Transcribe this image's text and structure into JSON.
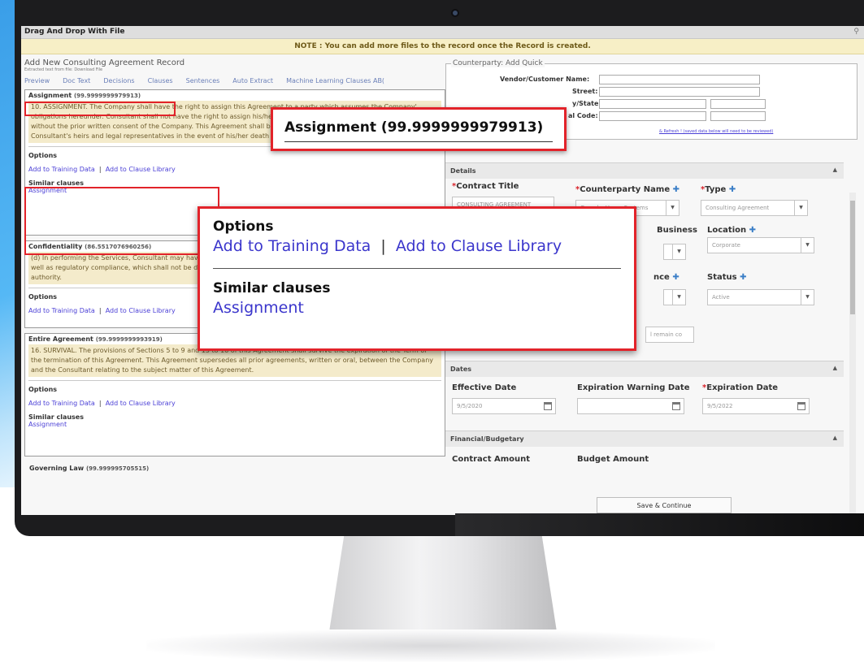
{
  "window": {
    "title": "Drag And Drop With File"
  },
  "note": "NOTE : You can add more files to the record once the Record is created.",
  "left": {
    "record_title": "Add New Consulting Agreement Record",
    "extracted": "Extracted text from file: Download File",
    "tabs": [
      "Preview",
      "Doc Text",
      "Decisions",
      "Clauses",
      "Sentences",
      "Auto Extract",
      "Machine Learning Clauses AB("
    ],
    "clauses": [
      {
        "title": "Assignment",
        "score": "(99.9999999979913)",
        "text": "10. ASSIGNMENT. The Company shall have the right to assign this Agreement to a party which assumes the Company' obligations hereunder. Consultant shall not have the right to assign his/her rights or obligations under this Agreement without the prior written consent of the Company. This Agreement shall be binding upon and inure to the benefit of the Consultant's heirs and legal representatives in the event of his/her death or disability.",
        "options_label": "Options",
        "link_training": "Add to Training Data",
        "link_sep": "|",
        "link_library": "Add to Clause Library",
        "similar_label": "Similar clauses",
        "similar": "Assignment"
      },
      {
        "title": "Confidentiality",
        "score": "(86.5517076960256)",
        "text": "(d) In performing the Services, Consultant may have access to confidential information regarding business operations as well as regulatory compliance, which shall not be disclosed except at the request of the Company for any governmental authority.",
        "options_label": "Options",
        "link_training": "Add to Training Data",
        "link_sep": "|",
        "link_library": "Add to Clause Library"
      },
      {
        "title": "Entire Agreement",
        "score": "(99.9999999993919)",
        "text": "16. SURVIVAL. The provisions of Sections 5 to 9 and 15 to 16 of this Agreement shall survive the expiration of the Term or the termination of this Agreement. This Agreement supersedes all prior agreements, written or oral, between the Company and the Consultant relating to the subject matter of this Agreement.",
        "options_label": "Options",
        "link_training": "Add to Training Data",
        "link_sep": "|",
        "link_library": "Add to Clause Library",
        "similar_label": "Similar clauses",
        "similar": "Assignment"
      },
      {
        "title": "Governing Law",
        "score": "(99.999995705515)"
      }
    ]
  },
  "right": {
    "counterparty_legend": "Counterparty: Add Quick",
    "vendor_label": "Vendor/Customer Name:",
    "street_label": "Street:",
    "city_label": "y/State:",
    "postal_label": "al Code:",
    "refresh_link": "& Refresh ! (saved data below will need to be reviewed)",
    "details": "Details",
    "contract_title_label": "Contract Title",
    "contract_title_value": "CONSULTING AGREEMENT",
    "counterparty_name_label": "Counterparty Name",
    "counterparty_value": "ComplexHome Systems",
    "type_label": "Type",
    "type_value": "Consulting Agreement",
    "business_label": "Business",
    "location_label": "Location",
    "location_value": "Corporate",
    "nce_label": "nce",
    "status_label": "Status",
    "status_value": "Active",
    "remain_value": "l remain co",
    "dates": "Dates",
    "effective_label": "Effective Date",
    "effective_value": "9/5/2020",
    "warning_label": "Expiration Warning Date",
    "expiration_label": "Expiration Date",
    "expiration_value": "9/5/2022",
    "financial": "Financial/Budgetary",
    "contract_amount_label": "Contract Amount",
    "budget_amount_label": "Budget Amount",
    "save_label": "Save & Continue"
  },
  "callout_assignment": {
    "title": "Assignment",
    "score": "(99.9999999979913)"
  },
  "callout_options": {
    "options_label": "Options",
    "link_training": "Add to Training Data",
    "link_sep": "|",
    "link_library": "Add to Clause Library",
    "similar_label": "Similar clauses",
    "similar": "Assignment"
  }
}
